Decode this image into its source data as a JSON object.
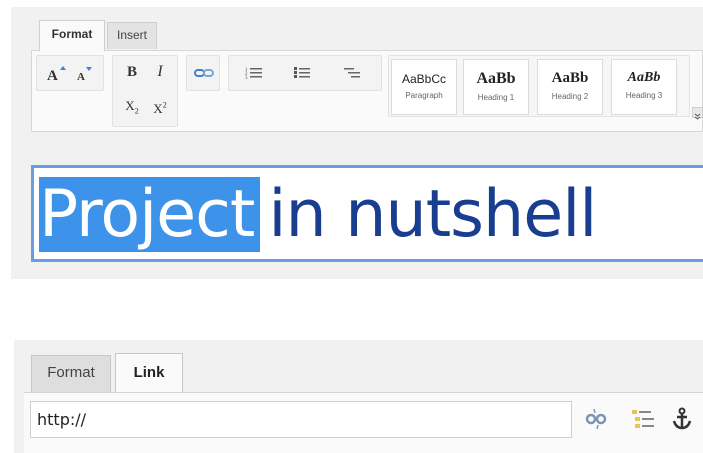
{
  "top": {
    "tabs": [
      {
        "label": "Format",
        "active": true
      },
      {
        "label": "Insert",
        "active": false
      }
    ],
    "styles": [
      {
        "sample": "AaBbCc",
        "name": "Paragraph"
      },
      {
        "sample": "AaBb",
        "name": "Heading 1"
      },
      {
        "sample": "AaBb",
        "name": "Heading 2"
      },
      {
        "sample": "AaBb",
        "name": "Heading 3"
      }
    ],
    "title": {
      "selected_text": "Project",
      "rest_text": "in nutshell"
    }
  },
  "bottom": {
    "tabs": [
      {
        "label": "Format",
        "active": false
      },
      {
        "label": "Link",
        "active": true
      }
    ],
    "url_value": "http://"
  },
  "colors": {
    "selection": "#3d92ea",
    "title_text": "#1a3e8f",
    "focus_border": "#6a9ce0"
  }
}
